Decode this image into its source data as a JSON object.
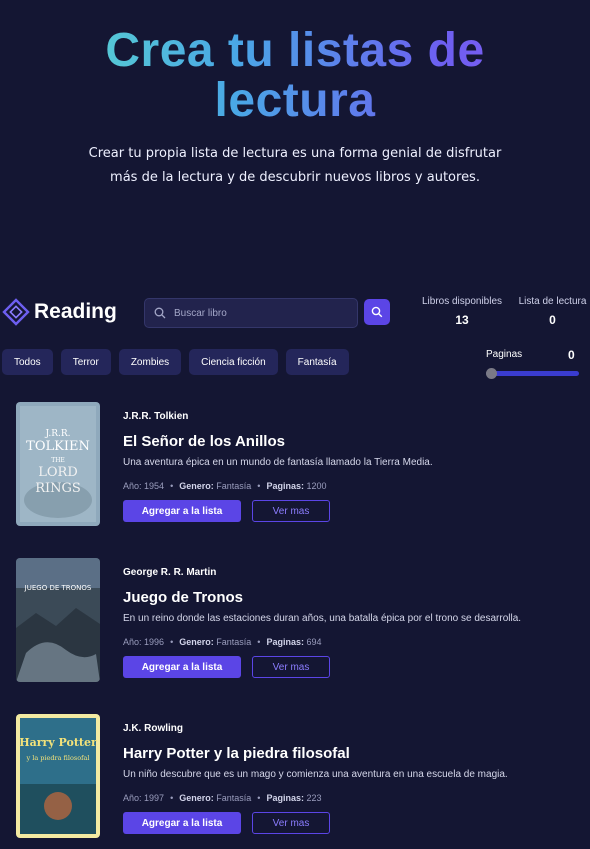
{
  "hero": {
    "title_line1": "Crea tu listas de",
    "title_line2": "lectura",
    "subtitle_line1": "Crear tu propia lista de lectura es una forma genial de disfrutar",
    "subtitle_line2": "más de la lectura y de descubrir nuevos libros y autores."
  },
  "header": {
    "logo_text": "Reading",
    "search_placeholder": "Buscar libro",
    "stats": {
      "available_label": "Libros disponibles",
      "available_value": "13",
      "list_label": "Lista de lectura",
      "list_value": "0"
    }
  },
  "filters": {
    "chips": [
      "Todos",
      "Terror",
      "Zombies",
      "Ciencia ficción",
      "Fantasía"
    ],
    "pages_label": "Paginas",
    "pages_value": "0",
    "pages_slider_fraction": 0
  },
  "books": [
    {
      "author": "J.R.R. Tolkien",
      "title": "El Señor de los Anillos",
      "description": "Una aventura épica en un mundo de fantasía llamado la Tierra Media.",
      "year_label": "Año:",
      "year": "1954",
      "genre_label": "Genero:",
      "genre": "Fantasía",
      "pages_label": "Paginas:",
      "pages": "1200",
      "add_label": "Agregar a la lista",
      "more_label": "Ver mas",
      "cover": {
        "line1": "J.R.R.",
        "line2": "TOLKIEN",
        "line3": "THE",
        "line4": "LORD",
        "line5": "RINGS"
      }
    },
    {
      "author": "George R. R. Martin",
      "title": "Juego de Tronos",
      "description": "En un reino donde las estaciones duran años, una batalla épica por el trono se desarrolla.",
      "year_label": "Año:",
      "year": "1996",
      "genre_label": "Genero:",
      "genre": "Fantasía",
      "pages_label": "Paginas:",
      "pages": "694",
      "add_label": "Agregar a la lista",
      "more_label": "Ver mas",
      "cover": {
        "line1": "JUEGO DE TRONOS"
      }
    },
    {
      "author": "J.K. Rowling",
      "title": "Harry Potter y la piedra filosofal",
      "description": "Un niño descubre que es un mago y comienza una aventura en una escuela de magia.",
      "year_label": "Año:",
      "year": "1997",
      "genre_label": "Genero:",
      "genre": "Fantasía",
      "pages_label": "Paginas:",
      "pages": "223",
      "add_label": "Agregar a la lista",
      "more_label": "Ver mas",
      "cover": {
        "line1": "Harry Potter",
        "line2": "y la piedra filosofal"
      }
    }
  ],
  "colors": {
    "background": "#141633",
    "accent": "#5b45e6",
    "chip": "#24265a"
  }
}
